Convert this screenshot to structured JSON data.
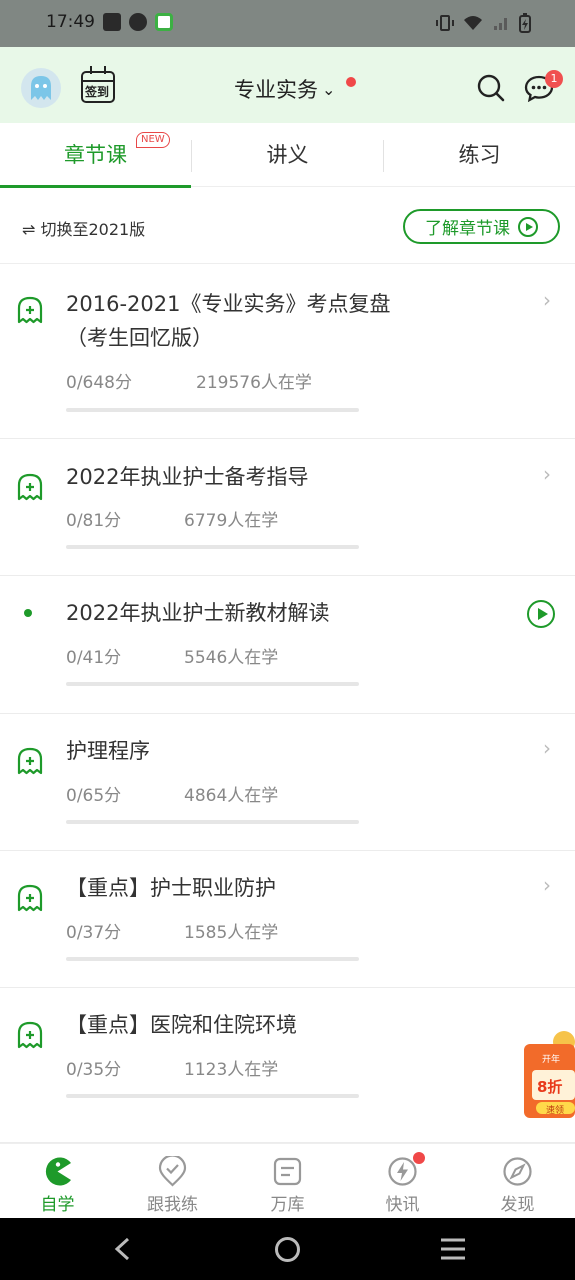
{
  "status_bar": {
    "time": "17:49"
  },
  "header": {
    "signin_label": "签到",
    "subject": "专业实务",
    "message_badge": "1"
  },
  "tabs": [
    {
      "label": "章节课",
      "tag": "NEW"
    },
    {
      "label": "讲义"
    },
    {
      "label": "练习"
    }
  ],
  "switch_bar": {
    "switch_text": "⇌ 切换至2021版",
    "learn_button": "了解章节课"
  },
  "courses": [
    {
      "title": "2016-2021《专业实务》考点复盘（考生回忆版）",
      "score": "0/648分",
      "learners": "219576人在学",
      "progress": 0,
      "state": "locked"
    },
    {
      "title": "2022年执业护士备考指导",
      "score": "0/81分",
      "learners": "6779人在学",
      "progress": 0,
      "state": "locked"
    },
    {
      "title": "2022年执业护士新教材解读",
      "score": "0/41分",
      "learners": "5546人在学",
      "progress": 0,
      "state": "playing"
    },
    {
      "title": "护理程序",
      "score": "0/65分",
      "learners": "4864人在学",
      "progress": 0,
      "state": "locked"
    },
    {
      "title": "【重点】护士职业防护",
      "score": "0/37分",
      "learners": "1585人在学",
      "progress": 0,
      "state": "locked"
    },
    {
      "title": "【重点】医院和住院环境",
      "score": "0/35分",
      "learners": "1123人在学",
      "progress": 0,
      "state": "locked"
    }
  ],
  "promo": {
    "line1": "开年",
    "line2": "8折",
    "line3": "速领"
  },
  "bottom_nav": [
    {
      "label": "自学",
      "icon": "pacman-icon",
      "active": true
    },
    {
      "label": "跟我练",
      "icon": "practice-icon"
    },
    {
      "label": "万库",
      "icon": "library-icon"
    },
    {
      "label": "快讯",
      "icon": "flash-icon",
      "dot": true
    },
    {
      "label": "发现",
      "icon": "compass-icon"
    }
  ],
  "colors": {
    "accent": "#1e9a2a",
    "header_bg": "#e8f8e8",
    "badge_red": "#f04848"
  }
}
